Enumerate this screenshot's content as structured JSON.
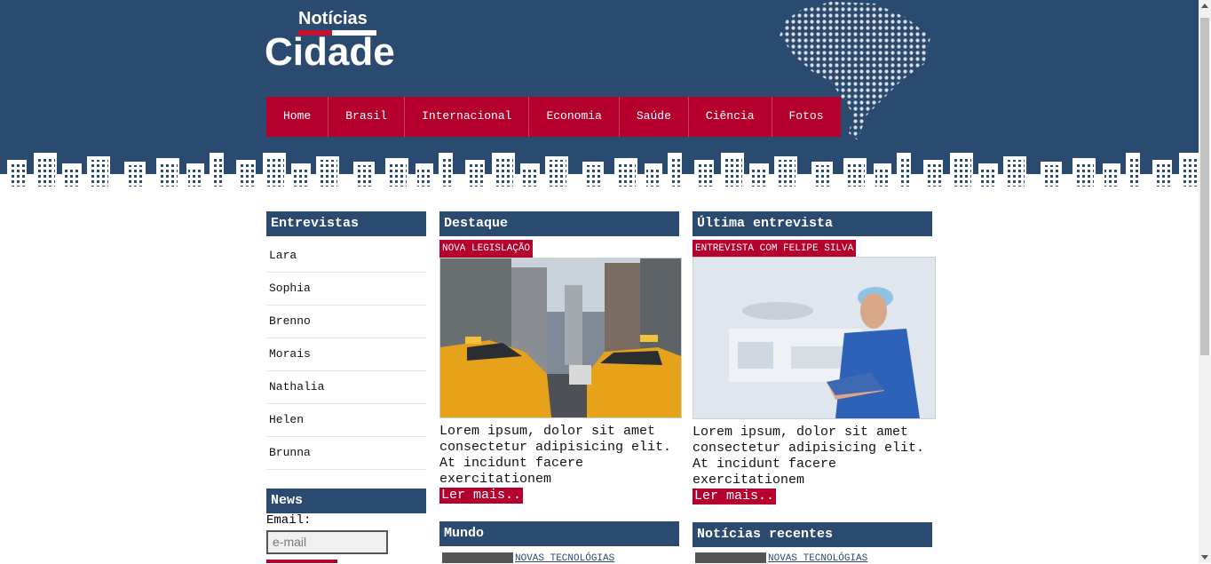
{
  "logo": {
    "top": "Notícias",
    "main": "Cidade"
  },
  "nav": [
    "Home",
    "Brasil",
    "Internacional",
    "Economia",
    "Saúde",
    "Ciência",
    "Fotos"
  ],
  "sidebar": {
    "title": "Entrevistas",
    "items": [
      "Lara",
      "Sophia",
      "Brenno",
      "Morais",
      "Nathalia",
      "Helen",
      "Brunna"
    ],
    "news_title": "News",
    "email_label": "Email:",
    "email_placeholder": "e-mail"
  },
  "destaque": {
    "title": "Destaque",
    "tag": "NOVA LEGISLAÇÃO",
    "text": "Lorem ipsum, dolor sit amet consectetur adipisicing elit. At incidunt facere exercitationem",
    "more": "Ler mais.."
  },
  "entrevista": {
    "title": "Última entrevista",
    "tag": "ENTREVISTA COM FELIPE SILVA",
    "text": "Lorem ipsum, dolor sit amet consectetur adipisicing elit. At incidunt facere exercitationem",
    "more": "Ler mais.."
  },
  "mundo": {
    "title": "Mundo",
    "link": "NOVAS TECNOLÓGIAS"
  },
  "recentes": {
    "title": "Notícias recentes",
    "link": "NOVAS TECNOLÓGIAS"
  },
  "colors": {
    "header_bg": "#2b4a6f",
    "accent_red": "#b5002d"
  }
}
